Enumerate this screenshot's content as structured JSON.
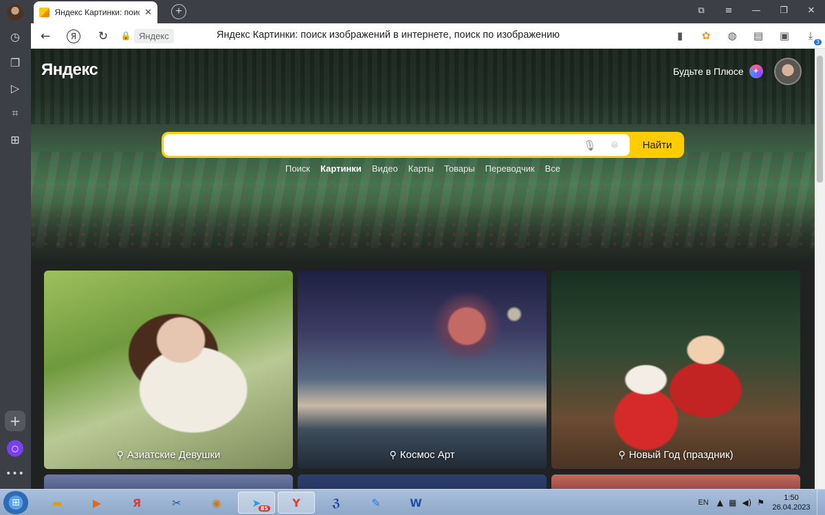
{
  "browser": {
    "tab": {
      "title": "Яндекс Картинки: поиск изображений в интернете, поиск по изображению",
      "close": "✕"
    },
    "new_tab": "+",
    "window_buttons": {
      "collections": "⧉",
      "menu": "≡",
      "minimize": "—",
      "restore": "❐",
      "close": "✕"
    },
    "address": {
      "domain": "Яндекс",
      "page_title": "Яндекс Картинки: поиск изображений в интернете, поиск по изображению"
    },
    "rail": {
      "add": "+",
      "alice": "○",
      "more": "•••"
    },
    "downloads_badge": "3"
  },
  "header": {
    "logo": "Яндекс",
    "plus_label": "Будьте в Плюсе",
    "plus_icon_text": "+"
  },
  "search": {
    "value": "",
    "placeholder": "",
    "button": "Найти"
  },
  "services": [
    "Поиск",
    "Картинки",
    "Видео",
    "Карты",
    "Товары",
    "Переводчик",
    "Все"
  ],
  "active_service": "Картинки",
  "cards": [
    {
      "label": "Азиатские Девушки"
    },
    {
      "label": "Космос Арт"
    },
    {
      "label": "Новый Год (праздник)"
    }
  ],
  "taskbar": {
    "apps": [
      "explorer",
      "media",
      "yandex-browser",
      "screenshot",
      "eye",
      "telegram",
      "yandex-disk",
      "app",
      "paint",
      "word"
    ],
    "telegram_badge": "85",
    "lang": "EN",
    "time": "1:50",
    "date": "26.04.2023"
  },
  "colors": {
    "accent": "#ffcc00",
    "chrome_dark": "#3c4046",
    "taskbar": "#a9c0dc"
  }
}
